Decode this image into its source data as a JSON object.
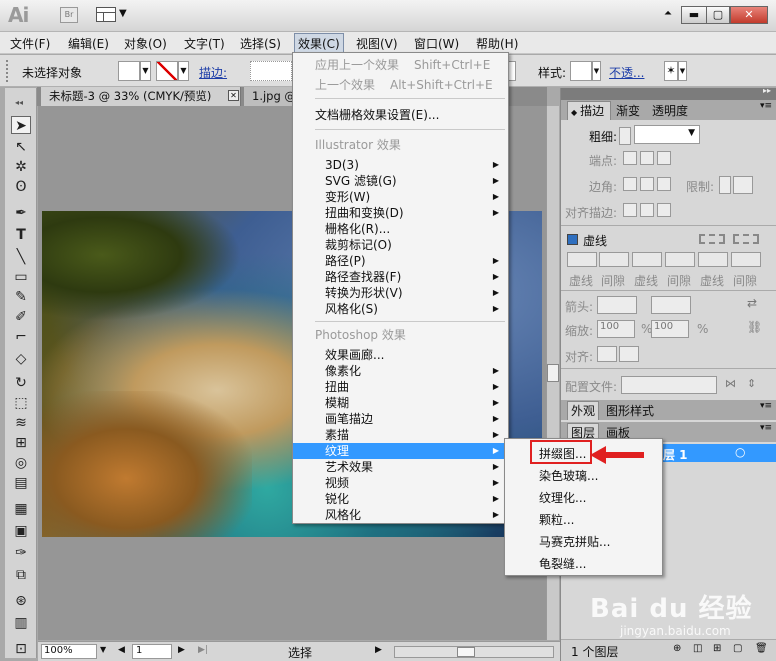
{
  "app": {
    "logo": "Ai",
    "bridge": "Br"
  },
  "menubar": [
    "文件(F)",
    "编辑(E)",
    "对象(O)",
    "文字(T)",
    "选择(S)",
    "效果(C)",
    "视图(V)",
    "窗口(W)",
    "帮助(H)"
  ],
  "control": {
    "selection": "未选择对象",
    "stroke": "描边:",
    "style": "样式:",
    "opacity": "不透..."
  },
  "tabs": {
    "doc1": "未标题-3 @ 33% (CMYK/预览)",
    "doc2": "1.jpg @"
  },
  "effects_menu": {
    "apply_last": "应用上一个效果",
    "apply_last_sc": "Shift+Ctrl+E",
    "last": "上一个效果",
    "last_sc": "Alt+Shift+Ctrl+E",
    "raster": "文档栅格效果设置(E)...",
    "ill_header": "Illustrator 效果",
    "ill_items": [
      "3D(3)",
      "SVG 滤镜(G)",
      "变形(W)",
      "扭曲和变换(D)",
      "栅格化(R)...",
      "裁剪标记(O)",
      "路径(P)",
      "路径查找器(F)",
      "转换为形状(V)",
      "风格化(S)"
    ],
    "ps_header": "Photoshop 效果",
    "ps_items": [
      "效果画廊...",
      "像素化",
      "扭曲",
      "模糊",
      "画笔描边",
      "素描",
      "纹理",
      "艺术效果",
      "视频",
      "锐化",
      "风格化"
    ]
  },
  "texture_submenu": [
    "拼缀图...",
    "染色玻璃...",
    "纹理化...",
    "颗粒...",
    "马赛克拼贴...",
    "龟裂缝..."
  ],
  "panel": {
    "tabs": [
      "描边",
      "渐变",
      "透明度"
    ],
    "weight": "粗细:",
    "cap": "端点:",
    "corner": "边角:",
    "limit": "限制:",
    "align": "对齐描边:",
    "dashed": "虚线",
    "dash_labels": [
      "虚线",
      "间隙",
      "虚线",
      "间隙",
      "虚线",
      "间隙"
    ],
    "arrow": "箭头:",
    "scale": "缩放:",
    "scale1": "100",
    "scale2": "100",
    "pct": "%",
    "align2": "对齐:",
    "profile": "配置文件:",
    "tabs2": [
      "外观",
      "图形样式"
    ],
    "tabs3": [
      "图层",
      "画板"
    ],
    "layer": "层 1",
    "layer_count": "1 个图层"
  },
  "status": {
    "zoom": "100%",
    "page": "1",
    "mode": "选择"
  },
  "watermark": {
    "brand": "Bai du 经验",
    "url": "jingyan.baidu.com"
  }
}
